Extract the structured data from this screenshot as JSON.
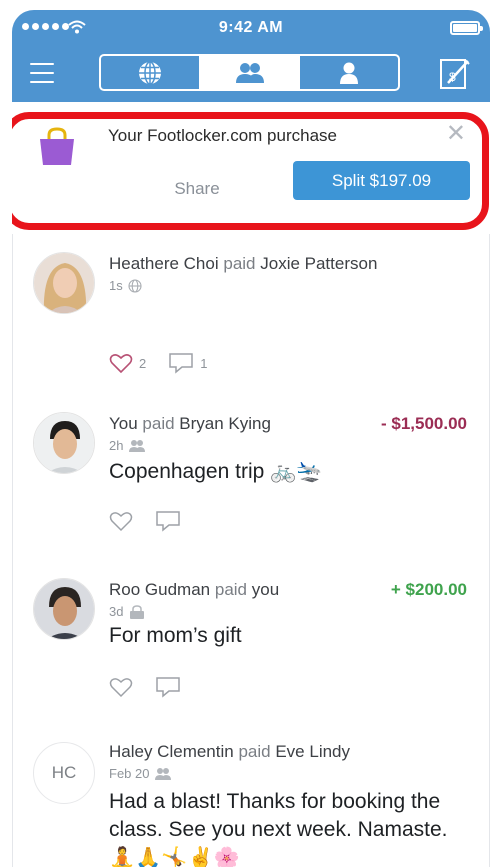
{
  "status_bar": {
    "time": "9:42 AM"
  },
  "header": {
    "tabs": [
      {
        "name": "public",
        "icon": "globe-icon",
        "active": false
      },
      {
        "name": "friends",
        "icon": "friends-icon",
        "active": true
      },
      {
        "name": "personal",
        "icon": "person-icon",
        "active": false
      }
    ]
  },
  "banner": {
    "title": "Your Footlocker.com purchase",
    "share_label": "Share",
    "split_label": "Split $197.09",
    "close_glyph": "✕"
  },
  "feed": [
    {
      "actor": "Heathere Choi",
      "verb": "paid",
      "target": "Joxie Patterson",
      "time": "1s",
      "privacy_icon": "globe-icon",
      "amount": "",
      "note": "",
      "likes": "2",
      "comments": "1"
    },
    {
      "actor": "You",
      "verb": "paid",
      "target": "Bryan Kying",
      "time": "2h",
      "privacy_icon": "friends-icon",
      "amount": "- $1,500.00",
      "note": "Copenhagen trip 🚲🛬"
    },
    {
      "actor": "Roo Gudman",
      "verb": "paid",
      "target": "you",
      "time": "3d",
      "privacy_icon": "lock-icon",
      "amount": "+ $200.00",
      "note": "For mom’s gift"
    },
    {
      "initials": "HC",
      "actor": "Haley Clementin",
      "verb": "paid",
      "target": "Eve Lindy",
      "time": "Feb 20",
      "privacy_icon": "friends-icon",
      "note_line1": "Had a blast! Thanks for booking the",
      "note_line2": "class. See you next week. Namaste.",
      "note_line3": "🧘🙏🤸✌️🌸"
    }
  ],
  "colors": {
    "header": "#4e94d0",
    "accent_button": "#3d95d6",
    "negative": "#9b2d54",
    "positive": "#3fa34d",
    "highlight": "#e8141b"
  }
}
